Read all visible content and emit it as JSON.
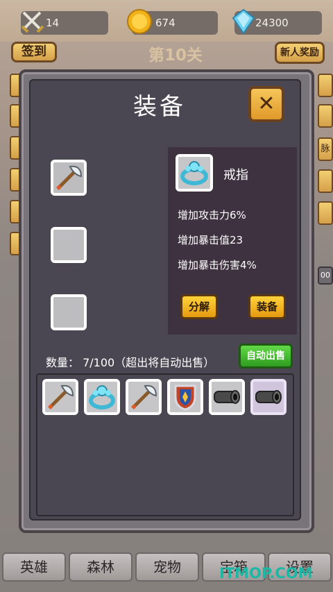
{
  "resources": {
    "attack": "14",
    "gold": "674",
    "gems": "24300"
  },
  "buttons": {
    "sign_in": "签到",
    "newbie_reward": "新人奖励"
  },
  "level": "第10关",
  "behind_panel": {
    "side_right_1": "脉",
    "side_right_2": "00"
  },
  "modal": {
    "title": "装备",
    "selected_item": {
      "name": "戒指",
      "stats": [
        "增加攻击力6%",
        "增加暴击值23",
        "增加暴击伤害4%"
      ]
    },
    "decompose_label": "分解",
    "equip_label": "装备",
    "quantity_text": "数量：  7/100（超出将自动出售）",
    "auto_sell_label": "自动出售",
    "equipped_slots": [
      "axe",
      "empty",
      "empty"
    ],
    "inventory": [
      "axe",
      "ring",
      "axe",
      "shield",
      "cannon",
      "cannon"
    ]
  },
  "nav": {
    "tabs": [
      "英雄",
      "森林",
      "宠物",
      "宝箱",
      "设置"
    ]
  },
  "watermark": "ITMOP.COM",
  "colors": {
    "accent_gold": "#f3cf73",
    "confirm_yellow": "#ffd23a",
    "auto_sell_green": "#3fb52a",
    "panel_dark": "#4a4752"
  }
}
